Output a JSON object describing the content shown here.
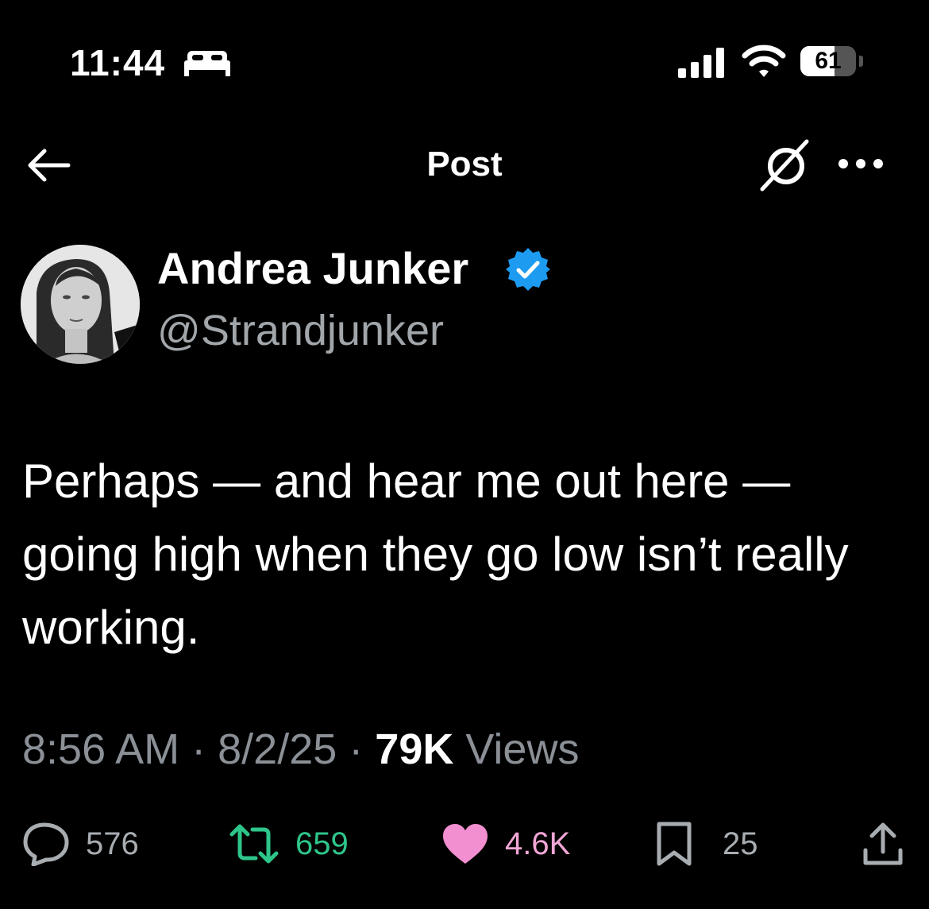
{
  "status_bar": {
    "time": "11:44",
    "focus_icon": "bed-icon",
    "signal_icon": "cellular-signal-icon",
    "wifi_icon": "wifi-icon",
    "battery_level": "61",
    "battery_fraction": 0.61
  },
  "header": {
    "back_icon": "arrow-left-icon",
    "title": "Post",
    "grok_icon": "grok-icon",
    "more_icon": "more-horizontal-icon"
  },
  "author": {
    "name": "Andrea Junker",
    "handle": "@Strandjunker",
    "verified": true,
    "verified_color": "#1d9bf0"
  },
  "tweet": {
    "text": "Perhaps — and hear me out here — going high when they go low isn’t really working."
  },
  "meta": {
    "time": "8:56 AM",
    "sep1": "·",
    "date": "8/2/25",
    "sep2": "·",
    "views_count": "79K",
    "views_label": "Views"
  },
  "actions": {
    "reply": {
      "icon": "reply-bubble-icon",
      "count": "576",
      "color": "#a8adb2"
    },
    "repost": {
      "icon": "repost-icon",
      "count": "659",
      "color": "#2ec58a"
    },
    "like": {
      "icon": "heart-icon",
      "count": "4.6K",
      "color": "#f28fd0"
    },
    "bookmark": {
      "icon": "bookmark-icon",
      "count": "25",
      "color": "#a8adb2"
    },
    "share": {
      "icon": "share-icon"
    }
  }
}
